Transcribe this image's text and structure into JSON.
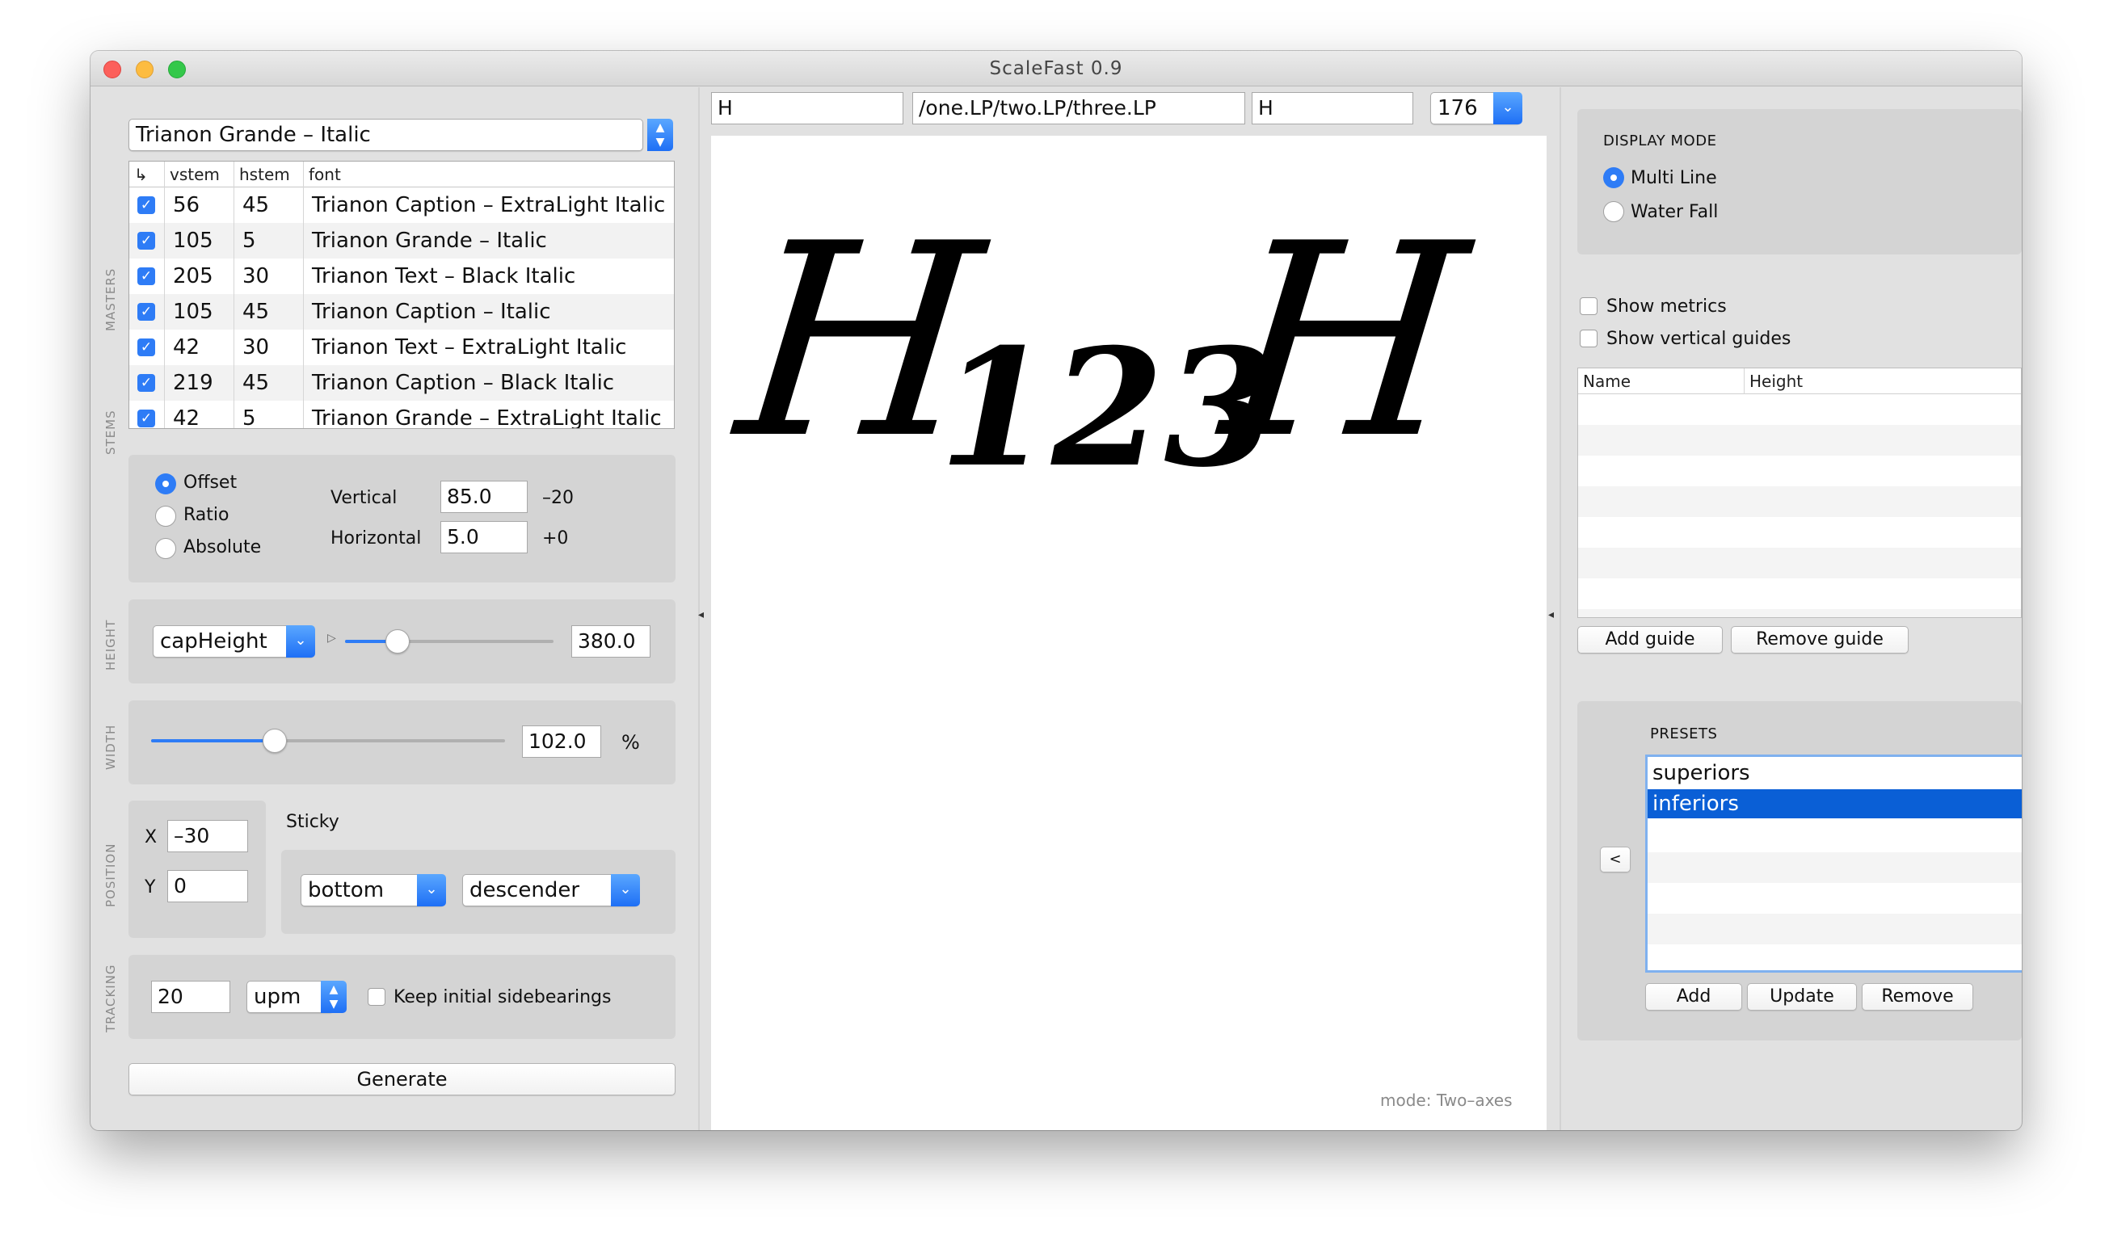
{
  "window": {
    "title": "ScaleFast 0.9"
  },
  "font_selector": {
    "value": "Trianon Grande – Italic"
  },
  "masters": {
    "label": "MASTERS",
    "columns": {
      "check": "↳",
      "vstem": "vstem",
      "hstem": "hstem",
      "font": "font"
    },
    "rows": [
      {
        "checked": true,
        "vstem": "56",
        "hstem": "45",
        "font": "Trianon Caption – ExtraLight Italic"
      },
      {
        "checked": true,
        "vstem": "105",
        "hstem": "5",
        "font": "Trianon Grande – Italic"
      },
      {
        "checked": true,
        "vstem": "205",
        "hstem": "30",
        "font": "Trianon Text – Black Italic"
      },
      {
        "checked": true,
        "vstem": "105",
        "hstem": "45",
        "font": "Trianon Caption – Italic"
      },
      {
        "checked": true,
        "vstem": "42",
        "hstem": "30",
        "font": "Trianon Text – ExtraLight Italic"
      },
      {
        "checked": true,
        "vstem": "219",
        "hstem": "45",
        "font": "Trianon Caption – Black Italic"
      },
      {
        "checked": true,
        "vstem": "42",
        "hstem": "5",
        "font": "Trianon Grande – ExtraLight Italic"
      }
    ]
  },
  "stems": {
    "label": "STEMS",
    "modes": [
      "Offset",
      "Ratio",
      "Absolute"
    ],
    "selected_mode": "Offset",
    "vertical_label": "Vertical",
    "vertical_value": "85.0",
    "vertical_delta": "–20",
    "horizontal_label": "Horizontal",
    "horizontal_value": "5.0",
    "horizontal_delta": "+0"
  },
  "height": {
    "label": "HEIGHT",
    "reference": "capHeight",
    "value": "380.0",
    "slider_fraction": 0.25
  },
  "width": {
    "label": "WIDTH",
    "value": "102.0",
    "unit": "%",
    "slider_fraction": 0.35
  },
  "position": {
    "label": "POSITION",
    "x_label": "X",
    "x_value": "–30",
    "y_label": "Y",
    "y_value": "0"
  },
  "sticky": {
    "label": "Sticky",
    "vertical": "bottom",
    "reference": "descender"
  },
  "tracking": {
    "label": "TRACKING",
    "value": "20",
    "unit": "upm",
    "keep_label": "Keep initial sidebearings",
    "keep_checked": false
  },
  "generate_button": "Generate",
  "preview": {
    "left_context": "H",
    "glyph_string": "/one.LP/two.LP/three.LP",
    "right_context": "H",
    "point_size": "176",
    "sample_left": "H",
    "sample_scaled": "123",
    "sample_right": "H",
    "mode_text": "mode: Two–axes"
  },
  "display_mode": {
    "label": "DISPLAY MODE",
    "options": [
      "Multi Line",
      "Water Fall"
    ],
    "selected": "Multi Line"
  },
  "metrics": {
    "show_metrics_label": "Show metrics",
    "show_metrics_checked": false,
    "show_guides_label": "Show vertical guides",
    "show_guides_checked": false,
    "columns": [
      "Name",
      "Height"
    ],
    "add_guide": "Add guide",
    "remove_guide": "Remove guide"
  },
  "presets": {
    "label": "PRESETS",
    "items": [
      "superiors",
      "inferiors"
    ],
    "selected": "inferiors",
    "back_button": "<",
    "add": "Add",
    "update": "Update",
    "remove": "Remove"
  },
  "colors": {
    "accent": "#2e7cf6",
    "selection": "#0a5fd6",
    "panel": "#e1e1e1",
    "group": "#d4d4d4"
  }
}
